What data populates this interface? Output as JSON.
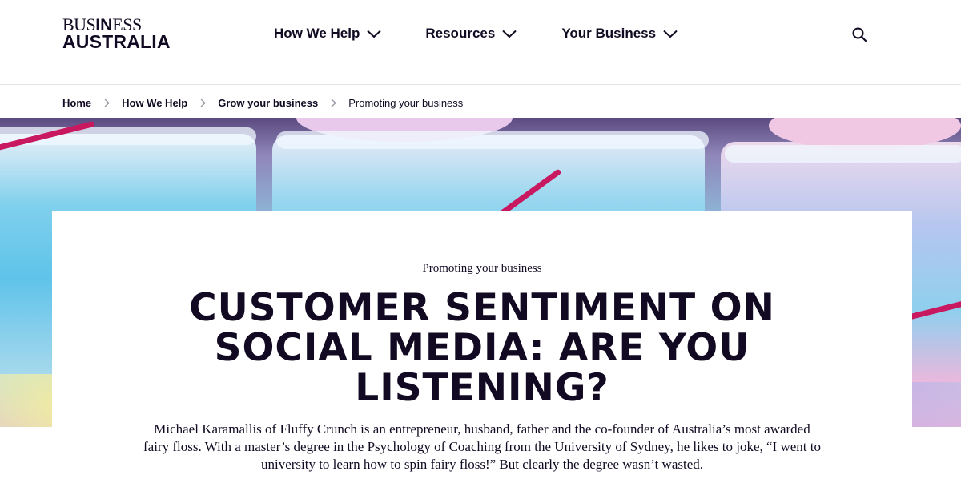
{
  "brand": {
    "line1_serif_a": "BUS",
    "line1_bold": "IN",
    "line1_serif_b": "ESS",
    "line2": "AUSTRALIA"
  },
  "nav": {
    "items": [
      {
        "label": "How We Help",
        "icon": "chevron-down-icon"
      },
      {
        "label": "Resources",
        "icon": "chevron-down-icon"
      },
      {
        "label": "Your Business",
        "icon": "chevron-down-icon"
      }
    ],
    "search_icon": "search-icon"
  },
  "breadcrumb": {
    "items": [
      "Home",
      "How We Help",
      "Grow your business"
    ],
    "current": "Promoting your business",
    "separator_icon": "chevron-right-icon"
  },
  "article": {
    "category": "Promoting your business",
    "title": "CUSTOMER SENTIMENT ON SOCIAL MEDIA: ARE YOU LISTENING?",
    "intro": "Michael Karamallis of Fluffy Crunch is an entrepreneur, husband, father and the co-founder of Australia’s most awarded fairy floss. With a master’s degree in the Psychology of Coaching from the University of Sydney, he likes to joke, “I went to university to learn how to spin fairy floss!” But clearly the degree wasn’t wasted."
  },
  "colors": {
    "text": "#120a22",
    "accent_pink": "#c8185f",
    "divider": "#e4e4e8"
  }
}
